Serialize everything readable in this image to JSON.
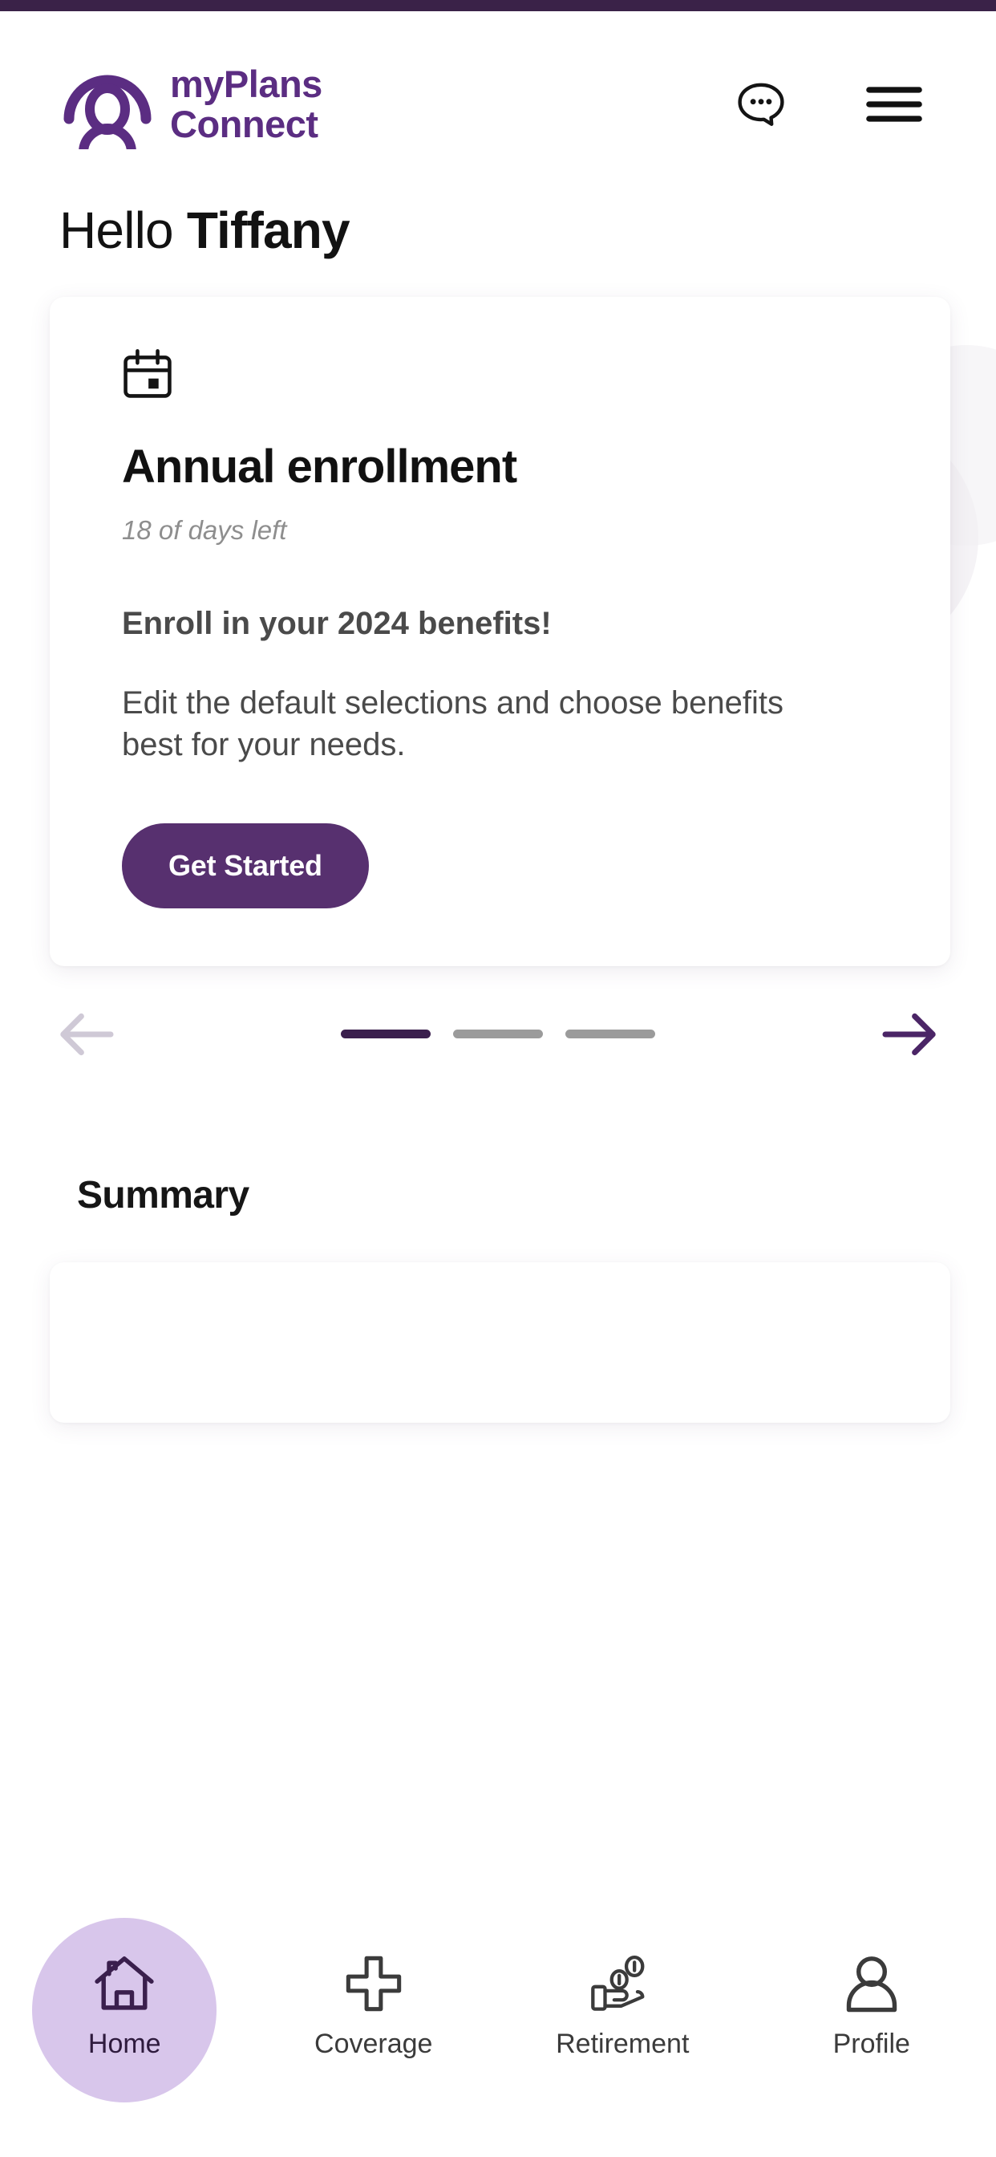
{
  "app": {
    "brand_line1": "myPlans",
    "brand_line2": "Connect",
    "brand_color": "#5B2D82",
    "status_bar_color": "#3A2248",
    "accent_color": "#57306F"
  },
  "header": {
    "chat_icon": "chat-bubble-dots-icon",
    "menu_icon": "hamburger-menu-icon"
  },
  "greeting": {
    "prefix": "Hello ",
    "name": "Tiffany"
  },
  "hero_card": {
    "icon": "calendar-icon",
    "title": "Annual enrollment",
    "subtitle": "18 of days left",
    "lead": "Enroll in your 2024 benefits!",
    "body": "Edit the default selections and choose benefits best for your needs.",
    "cta_label": "Get Started"
  },
  "carousel": {
    "prev_icon": "arrow-left-icon",
    "next_icon": "arrow-right-icon",
    "prev_enabled": false,
    "next_enabled": true,
    "total_slides": 3,
    "active_slide": 1,
    "active_dot_color": "#3A1F4D",
    "inactive_dot_color": "#9B9B9B"
  },
  "summary": {
    "title": "Summary"
  },
  "bottom_nav": {
    "active_index": 0,
    "active_pill_color": "#D8C6EB",
    "items": [
      {
        "label": "Home",
        "icon": "home-icon"
      },
      {
        "label": "Coverage",
        "icon": "plus-cross-icon"
      },
      {
        "label": "Retirement",
        "icon": "hand-coins-icon"
      },
      {
        "label": "Profile",
        "icon": "person-icon"
      }
    ]
  }
}
